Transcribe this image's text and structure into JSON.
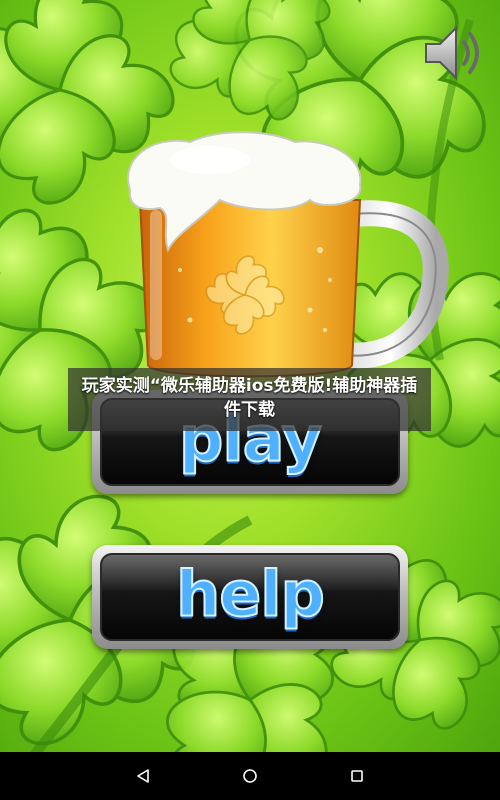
{
  "title_banner": {
    "text": "玩家实测“微乐辅助器ios免费版!辅助神器插件下载"
  },
  "menu": {
    "play_label": "play",
    "help_label": "help"
  },
  "icons": {
    "sound": "speaker-volume-icon",
    "beer": "beer-mug-with-clover",
    "back": "back-triangle-icon",
    "home": "home-circle-icon",
    "recents": "recents-square-icon"
  },
  "colors": {
    "background": "#8fd624",
    "button_text": "#4fb0ff",
    "nav_bar": "#000000"
  }
}
